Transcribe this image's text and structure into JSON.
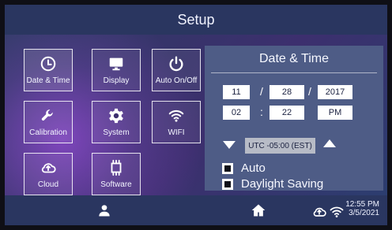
{
  "window": {
    "title": "Setup"
  },
  "tiles": [
    {
      "label": "Date & Time",
      "icon": "clock-icon",
      "active": true
    },
    {
      "label": "Display",
      "icon": "monitor-icon"
    },
    {
      "label": "Auto On/Off",
      "icon": "power-icon"
    },
    {
      "label": "Calibration",
      "icon": "wrench-icon"
    },
    {
      "label": "System",
      "icon": "gear-icon"
    },
    {
      "label": "WIFI",
      "icon": "wifi-icon"
    },
    {
      "label": "Cloud",
      "icon": "cloud-icon"
    },
    {
      "label": "Software",
      "icon": "chip-icon"
    }
  ],
  "panel": {
    "title": "Date & Time",
    "date": {
      "month": "11",
      "day": "28",
      "year": "2017",
      "sep": "/"
    },
    "time": {
      "hour": "02",
      "minute": "22",
      "ampm": "PM",
      "sep": ":"
    },
    "timezone": "UTC -05:00 (EST)",
    "options": [
      {
        "label": "Auto",
        "checked": true
      },
      {
        "label": "Daylight Saving",
        "checked": true
      }
    ]
  },
  "statusbar": {
    "time": "12:55 PM",
    "date": "3/5/2021"
  },
  "icons": {
    "user": "user-icon",
    "home": "home-icon",
    "cloud": "cloud-sync-icon",
    "wifi": "wifi-icon"
  },
  "colors": {
    "accent": "#2a3660",
    "panel": "#4e5c86",
    "glow": "#b955ff"
  }
}
